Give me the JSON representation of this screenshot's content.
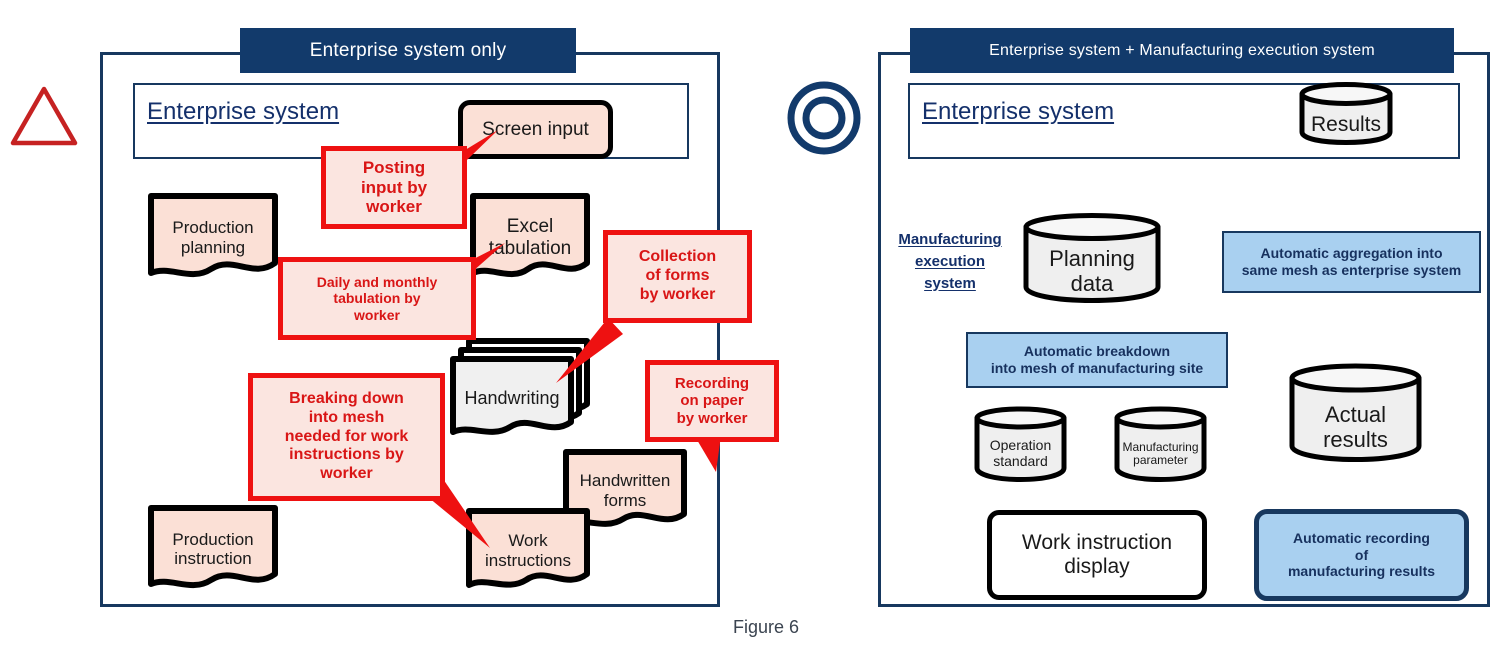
{
  "figure": {
    "caption": "Figure 6"
  },
  "left_panel": {
    "title": "Enterprise system only",
    "rating_icon": "triangle-icon",
    "inner_label": "Enterprise system",
    "nodes": [
      {
        "id": "screen_input",
        "label": "Screen input"
      },
      {
        "id": "production_planning",
        "label": "Production\nplanning"
      },
      {
        "id": "excel_tabulation",
        "label": "Excel\ntabulation"
      },
      {
        "id": "handwriting",
        "label": "Handwriting"
      },
      {
        "id": "handwritten_forms",
        "label": "Handwritten\nforms"
      },
      {
        "id": "production_instruction",
        "label": "Production\ninstruction"
      },
      {
        "id": "work_instructions",
        "label": "Work\ninstructions"
      }
    ],
    "callouts": [
      {
        "id": "posting",
        "label": "Posting\ninput by\nworker"
      },
      {
        "id": "daily",
        "label": "Daily and monthly\ntabulation by\nworker"
      },
      {
        "id": "collection",
        "label": "Collection\nof forms\nby worker"
      },
      {
        "id": "recording",
        "label": "Recording\non paper\nby worker"
      },
      {
        "id": "breaking",
        "label": "Breaking down\ninto mesh\nneeded for work\ninstructions by\nworker"
      }
    ]
  },
  "right_panel": {
    "title": "Enterprise system + Manufacturing execution system",
    "rating_icon": "double-circle-icon",
    "inner_label": "Enterprise system",
    "mes_label": "Manufacturing \nexecution \nsystem",
    "nodes": [
      {
        "id": "results",
        "label": "Results"
      },
      {
        "id": "planning_data",
        "label": "Planning\ndata"
      },
      {
        "id": "operation_standard",
        "label": "Operation\nstandard"
      },
      {
        "id": "manufacturing_parameter",
        "label": "Manufacturing\nparameter"
      },
      {
        "id": "actual_results",
        "label": "Actual\nresults"
      },
      {
        "id": "work_instruction_display",
        "label": "Work instruction\ndisplay"
      }
    ],
    "blue_boxes": [
      {
        "id": "aggregation",
        "label": "Automatic aggregation into\nsame mesh as enterprise system"
      },
      {
        "id": "breakdown",
        "label": "Automatic breakdown\ninto mesh of manufacturing site"
      },
      {
        "id": "recording",
        "label": "Automatic recording\nof\nmanufacturing results"
      }
    ]
  },
  "colors": {
    "navy": "#123a6b",
    "navy_border": "#17385f",
    "pink_fill": "#fbe0d6",
    "gray_fill": "#f0f0f0",
    "red": "#ee1111",
    "red_text": "#d91616",
    "light_blue": "#a9d0f0",
    "dashed_gray": "#a6a6a6"
  }
}
